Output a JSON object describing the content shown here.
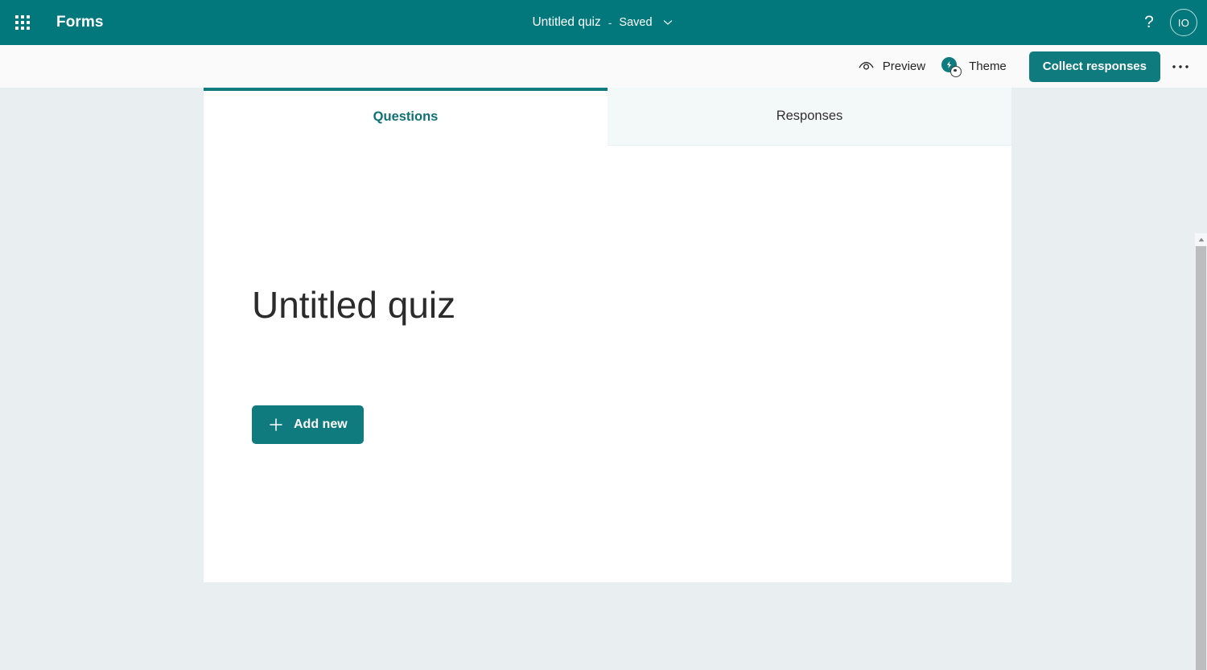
{
  "header": {
    "waffle_icon": "app-launcher-waffle-icon",
    "brand": "Forms",
    "doc_title": "Untitled quiz",
    "separator": "-",
    "save_status": "Saved",
    "title_chevron_icon": "chevron-down-icon",
    "help_icon": "?",
    "help_label": "help-question-icon",
    "avatar_initials": "IO",
    "bg_color": "#03787c"
  },
  "command_bar": {
    "preview": {
      "label": "Preview",
      "icon": "eye-icon"
    },
    "theme": {
      "label": "Theme",
      "icon": "theme-palette-sparkle-icon"
    },
    "collect_responses_label": "Collect responses",
    "more_options_label": "•••",
    "more_options_icon": "more-horizontal-icon",
    "accent_color": "#0f7b7e",
    "bg_color": "#fafafa"
  },
  "tabs": [
    {
      "label": "Questions",
      "state": "active"
    },
    {
      "label": "Responses",
      "state": "inactive"
    }
  ],
  "form": {
    "title": "Untitled quiz",
    "add_new": {
      "label": "Add new",
      "icon": "plus-icon"
    }
  },
  "scrollbar": {
    "up_arrow_icon": "scroll-up-arrow-icon",
    "thumb_name": "scrollbar-thumb"
  },
  "colors": {
    "page_background": "#e9eef1",
    "card_background": "#ffffff",
    "teal": "#0f7b7e",
    "tab_inactive_background": "#f3f8f8"
  }
}
